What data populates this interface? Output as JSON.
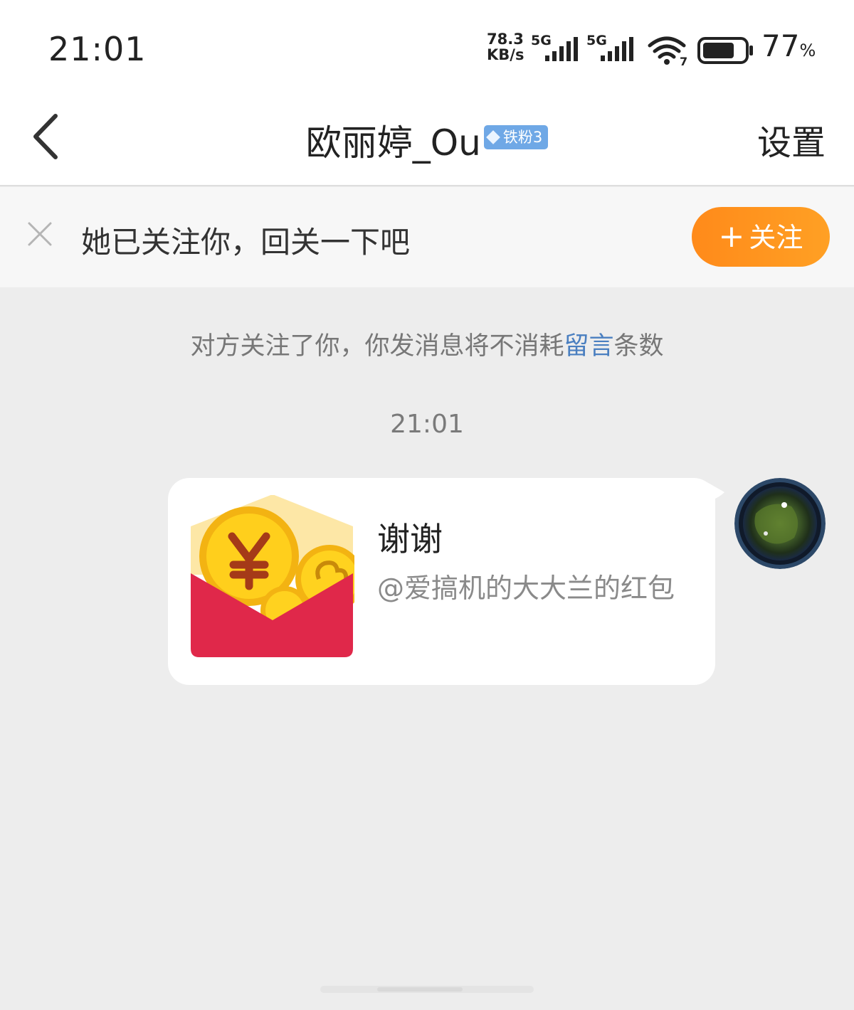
{
  "status_bar": {
    "time": "21:01",
    "net_speed_value": "78.3",
    "net_speed_unit": "KB/s",
    "sim1_network": "5G",
    "sim2_network": "5G",
    "wifi_label": "7",
    "battery_percent": "77",
    "battery_unit": "%",
    "battery_level": 0.77
  },
  "header": {
    "back_icon": "chevron-left-icon",
    "title": "欧丽婷_Ou",
    "badge": "铁粉3",
    "badge_color": "#6fa8e6",
    "settings_label": "设置"
  },
  "follow_banner": {
    "close_icon": "close-icon",
    "text": "她已关注你，回关一下吧",
    "button_plus": "+",
    "button_label": "关注",
    "button_color": "#ff9420"
  },
  "chat": {
    "notice_before": "对方关注了你，你发消息将不消耗",
    "notice_link": "留言",
    "notice_after": "条数",
    "notice_link_color": "#4a7fc0",
    "timestamp": "21:01",
    "message": {
      "type": "red-packet",
      "icon": "red-packet-icon",
      "title": "谢谢",
      "subtitle": "@爱搞机的大大兰的红包"
    }
  }
}
